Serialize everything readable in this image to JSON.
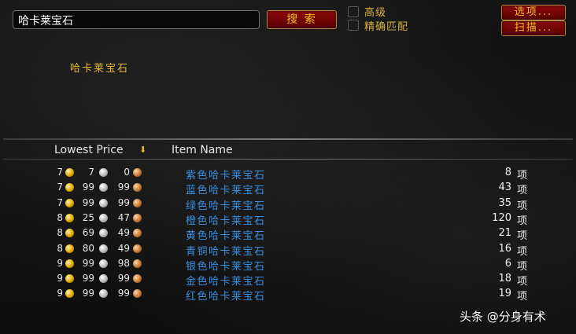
{
  "search": {
    "value": "哈卡莱宝石",
    "button_label": "搜 索"
  },
  "filters": {
    "advanced_label": "高级",
    "exact_label": "精确匹配"
  },
  "buttons": {
    "options_label": "选项...",
    "scan_label": "扫描..."
  },
  "detail": {
    "title": "哈卡莱宝石"
  },
  "columns": {
    "price": "Lowest Price",
    "name": "Item Name"
  },
  "currency_icons": {
    "gold": "gold-coin-icon",
    "silver": "silver-coin-icon",
    "copper": "copper-coin-icon"
  },
  "colors": {
    "accent_gold": "#e8b93a",
    "item_blue": "#3a8fe0",
    "button_red": "#8b0a0a"
  },
  "rows": [
    {
      "gold": "7",
      "silver": "7",
      "copper": "0",
      "name": "紫色哈卡莱宝石",
      "count": "8",
      "unit": "项"
    },
    {
      "gold": "7",
      "silver": "99",
      "copper": "99",
      "name": "蓝色哈卡莱宝石",
      "count": "43",
      "unit": "项"
    },
    {
      "gold": "7",
      "silver": "99",
      "copper": "99",
      "name": "绿色哈卡莱宝石",
      "count": "35",
      "unit": "项"
    },
    {
      "gold": "8",
      "silver": "25",
      "copper": "47",
      "name": "橙色哈卡莱宝石",
      "count": "120",
      "unit": "项"
    },
    {
      "gold": "8",
      "silver": "69",
      "copper": "49",
      "name": "黄色哈卡莱宝石",
      "count": "21",
      "unit": "项"
    },
    {
      "gold": "8",
      "silver": "80",
      "copper": "49",
      "name": "青铜哈卡莱宝石",
      "count": "16",
      "unit": "项"
    },
    {
      "gold": "9",
      "silver": "99",
      "copper": "98",
      "name": "银色哈卡莱宝石",
      "count": "6",
      "unit": "项"
    },
    {
      "gold": "9",
      "silver": "99",
      "copper": "99",
      "name": "金色哈卡莱宝石",
      "count": "18",
      "unit": "项"
    },
    {
      "gold": "9",
      "silver": "99",
      "copper": "99",
      "name": "红色哈卡莱宝石",
      "count": "19",
      "unit": "项"
    }
  ],
  "watermark": "头条 @分身有术"
}
